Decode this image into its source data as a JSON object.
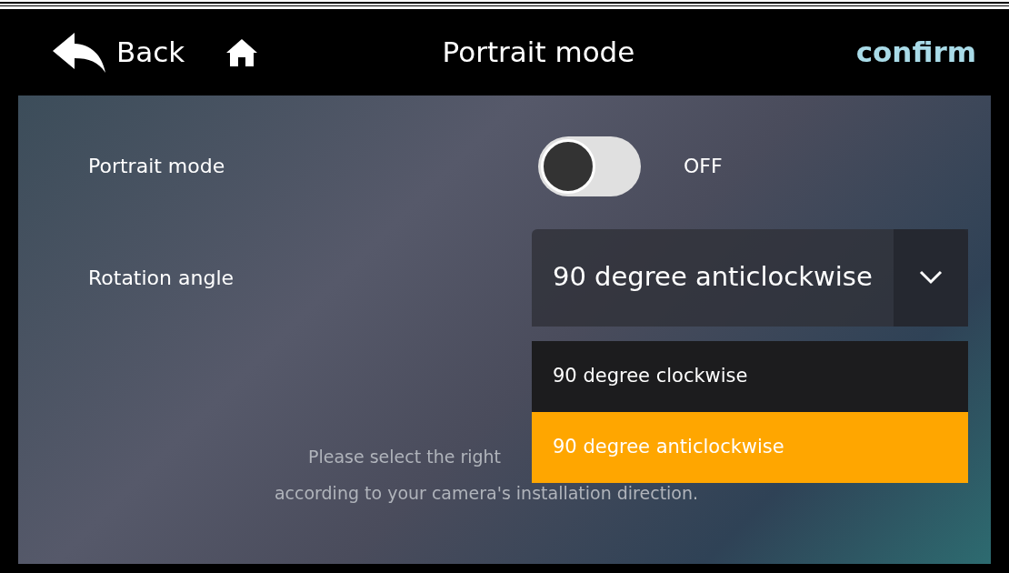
{
  "header": {
    "back": "Back",
    "title": "Portrait mode",
    "confirm": "confirm"
  },
  "portrait_mode": {
    "label": "Portrait mode",
    "on": false,
    "state_text": "OFF"
  },
  "rotation_angle": {
    "label": "Rotation angle",
    "value": "90 degree anticlockwise",
    "expanded": true,
    "options": [
      {
        "label": "90 degree clockwise",
        "selected": false
      },
      {
        "label": "90 degree anticlockwise",
        "selected": true
      }
    ]
  },
  "hint": [
    "Please select the right",
    "according to your camera's installation direction."
  ]
}
